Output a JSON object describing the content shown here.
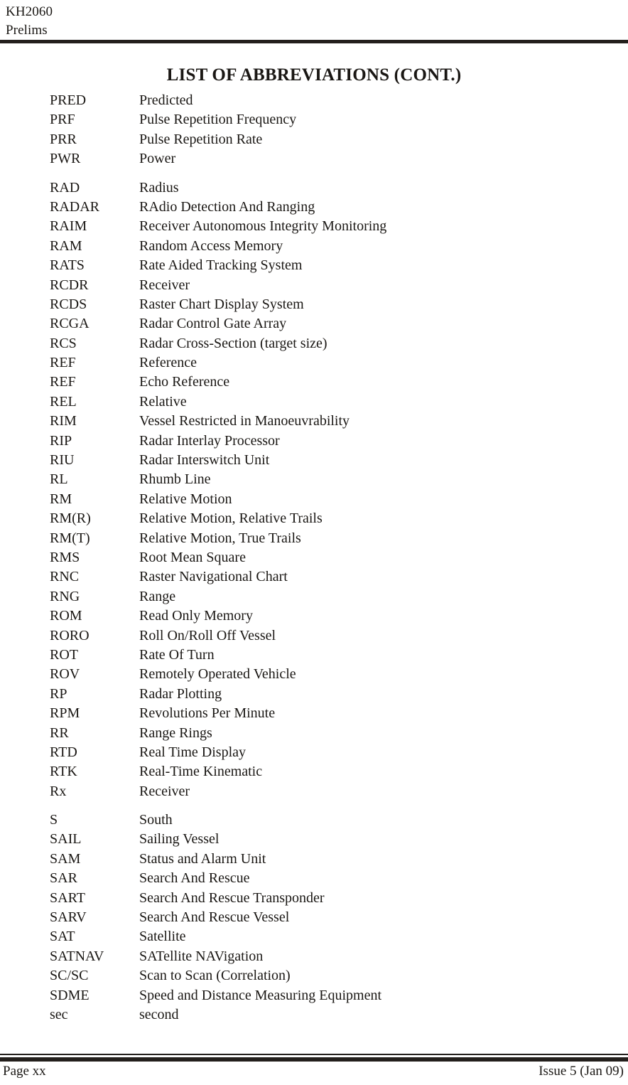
{
  "header": {
    "line1": "KH2060",
    "line2": "Prelims"
  },
  "title": "LIST OF ABBREVIATIONS (CONT.)",
  "groups": [
    {
      "entries": [
        {
          "term": "PRED",
          "definition": "Predicted"
        },
        {
          "term": "PRF",
          "definition": "Pulse Repetition Frequency"
        },
        {
          "term": "PRR",
          "definition": "Pulse Repetition Rate"
        },
        {
          "term": "PWR",
          "definition": "Power"
        }
      ]
    },
    {
      "entries": [
        {
          "term": "RAD",
          "definition": "Radius"
        },
        {
          "term": "RADAR",
          "definition": "RAdio Detection And Ranging"
        },
        {
          "term": "RAIM",
          "definition": "Receiver Autonomous Integrity Monitoring"
        },
        {
          "term": "RAM",
          "definition": "Random Access Memory"
        },
        {
          "term": "RATS",
          "definition": "Rate Aided Tracking System"
        },
        {
          "term": "RCDR",
          "definition": "Receiver"
        },
        {
          "term": "RCDS",
          "definition": "Raster Chart Display System"
        },
        {
          "term": "RCGA",
          "definition": "Radar Control Gate Array"
        },
        {
          "term": "RCS",
          "definition": "Radar Cross-Section (target size)"
        },
        {
          "term": "REF",
          "definition": "Reference"
        },
        {
          "term": "REF",
          "definition": "Echo Reference"
        },
        {
          "term": "REL",
          "definition": "Relative"
        },
        {
          "term": "RIM",
          "definition": "Vessel Restricted in Manoeuvrability"
        },
        {
          "term": "RIP",
          "definition": "Radar Interlay Processor"
        },
        {
          "term": "RIU",
          "definition": "Radar Interswitch Unit"
        },
        {
          "term": "RL",
          "definition": "Rhumb Line"
        },
        {
          "term": "RM",
          "definition": "Relative Motion"
        },
        {
          "term": "RM(R)",
          "definition": "Relative Motion, Relative Trails"
        },
        {
          "term": "RM(T)",
          "definition": "Relative Motion, True Trails"
        },
        {
          "term": "RMS",
          "definition": "Root Mean Square"
        },
        {
          "term": "RNC",
          "definition": "Raster Navigational Chart"
        },
        {
          "term": "RNG",
          "definition": "Range"
        },
        {
          "term": "ROM",
          "definition": "Read Only Memory"
        },
        {
          "term": "RORO",
          "definition": "Roll On/Roll Off Vessel"
        },
        {
          "term": "ROT",
          "definition": "Rate Of Turn"
        },
        {
          "term": "ROV",
          "definition": "Remotely Operated Vehicle"
        },
        {
          "term": "RP",
          "definition": "Radar Plotting"
        },
        {
          "term": "RPM",
          "definition": "Revolutions Per Minute"
        },
        {
          "term": "RR",
          "definition": "Range Rings"
        },
        {
          "term": "RTD",
          "definition": "Real Time Display"
        },
        {
          "term": "RTK",
          "definition": "Real-Time Kinematic"
        },
        {
          "term": "Rx",
          "definition": "Receiver"
        }
      ]
    },
    {
      "entries": [
        {
          "term": "S",
          "definition": "South"
        },
        {
          "term": "SAIL",
          "definition": "Sailing Vessel"
        },
        {
          "term": "SAM",
          "definition": "Status and Alarm Unit"
        },
        {
          "term": "SAR",
          "definition": "Search And Rescue"
        },
        {
          "term": "SART",
          "definition": "Search And Rescue Transponder"
        },
        {
          "term": "SARV",
          "definition": "Search And Rescue Vessel"
        },
        {
          "term": "SAT",
          "definition": "Satellite"
        },
        {
          "term": "SATNAV",
          "definition": "SATellite NAVigation"
        },
        {
          "term": "SC/SC",
          "definition": "Scan to Scan (Correlation)"
        },
        {
          "term": "SDME",
          "definition": "Speed and Distance Measuring Equipment"
        },
        {
          "term": "sec",
          "definition": "second"
        }
      ]
    }
  ],
  "footer": {
    "page": "Page xx",
    "issue": "Issue 5 (Jan 09)"
  }
}
